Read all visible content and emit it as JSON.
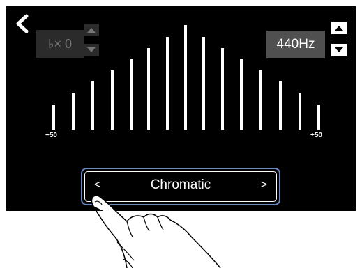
{
  "tuner": {
    "flat_display": "♭× 0",
    "reference_pitch": "440Hz",
    "scale_min_label": "−50",
    "scale_max_label": "+50",
    "mode_prev": "<",
    "mode_value": "Chromatic",
    "mode_next": ">"
  },
  "icons": {
    "back": "chevron-left-icon",
    "up": "triangle-up-icon",
    "down": "triangle-down-icon"
  },
  "colors": {
    "screen_bg": "#000000",
    "active_bar": "#ffffff",
    "selection_border": "#6a87bd"
  }
}
